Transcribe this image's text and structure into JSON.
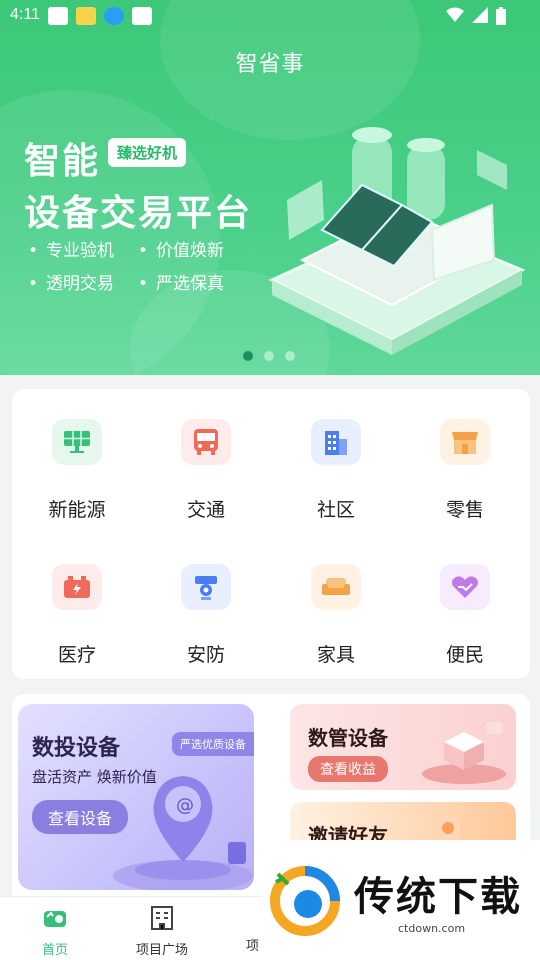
{
  "status_bar": {
    "time": "4:11"
  },
  "header": {
    "title": "智省事"
  },
  "banner": {
    "title_line1": "智能",
    "badge": "臻选好机",
    "title_line2": "设备交易平台",
    "features": [
      "专业验机",
      "价值焕新",
      "透明交易",
      "严选保真"
    ],
    "page_count": 3,
    "active_page": 1
  },
  "categories": [
    {
      "label": "新能源",
      "icon": "solar-panel-icon",
      "color": "#36c07a",
      "bg": "#e6f8ee"
    },
    {
      "label": "交通",
      "icon": "bus-icon",
      "color": "#f06a5a",
      "bg": "#fdeceb"
    },
    {
      "label": "社区",
      "icon": "building-icon",
      "color": "#4a7df0",
      "bg": "#e9efff"
    },
    {
      "label": "零售",
      "icon": "store-icon",
      "color": "#f3a24a",
      "bg": "#fff2e4"
    },
    {
      "label": "医疗",
      "icon": "battery-icon",
      "color": "#f06a5a",
      "bg": "#fdeceb"
    },
    {
      "label": "安防",
      "icon": "camera-icon",
      "color": "#4a7df0",
      "bg": "#e9efff"
    },
    {
      "label": "家具",
      "icon": "sofa-icon",
      "color": "#f3a24a",
      "bg": "#fff2e4"
    },
    {
      "label": "便民",
      "icon": "heart-hand-icon",
      "color": "#c07ae8",
      "bg": "#f6ecfd"
    }
  ],
  "promos": {
    "big": {
      "title": "数投设备",
      "tag": "严选优质设备",
      "subtitle": "盘活资产 焕新价值",
      "button": "查看设备"
    },
    "right_top": {
      "title": "数管设备",
      "button": "查看收益"
    },
    "right_bottom": {
      "title": "邀请好友"
    }
  },
  "bottom_nav": [
    {
      "label": "首页",
      "icon": "home-icon",
      "active": true
    },
    {
      "label": "项目广场",
      "icon": "grid-building-icon",
      "active": false
    },
    {
      "label": "项",
      "icon": "project-icon",
      "active": false
    }
  ],
  "watermark": {
    "text": "传统下载",
    "url": "ctdown.com"
  }
}
